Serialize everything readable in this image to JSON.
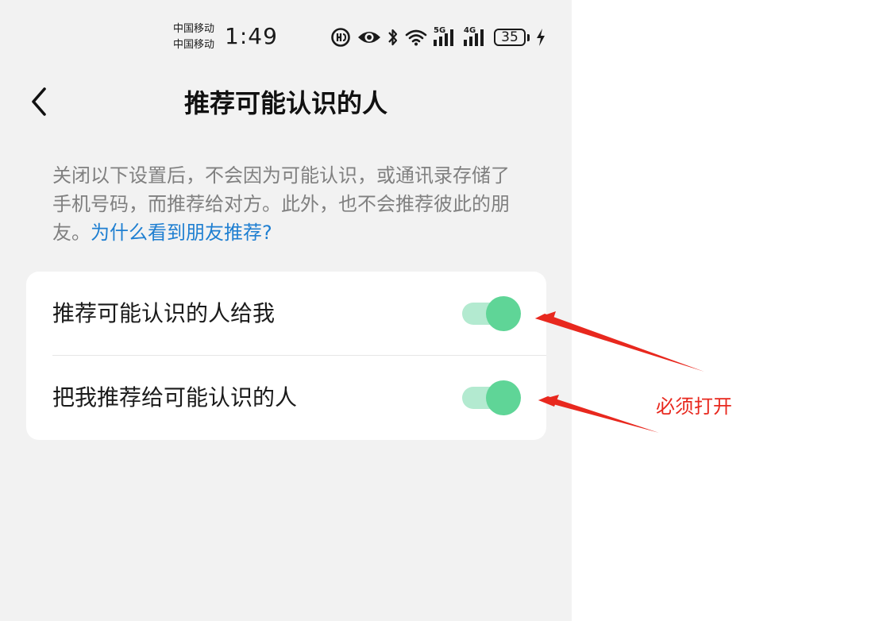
{
  "status_bar": {
    "carrier_1": "中国移动",
    "carrier_2": "中国移动",
    "time": "1:49",
    "network_1": "5G",
    "network_2": "4G",
    "battery": "35",
    "icons": [
      "hd-call-icon",
      "eye-icon",
      "bluetooth-icon",
      "wifi-icon",
      "signal-5g-icon",
      "signal-4g-icon",
      "battery-icon",
      "charging-icon"
    ]
  },
  "header": {
    "back_icon": "chevron-left-icon",
    "title": "推荐可能认识的人"
  },
  "description": {
    "text": "关闭以下设置后，不会因为可能认识，或通讯录存储了手机号码，而推荐给对方。此外，也不会推荐彼此的朋友。",
    "link": "为什么看到朋友推荐?"
  },
  "settings": [
    {
      "label": "推荐可能认识的人给我",
      "enabled": true
    },
    {
      "label": "把我推荐给可能认识的人",
      "enabled": true
    }
  ],
  "colors": {
    "page_background": "#f2f2f2",
    "card_background": "#ffffff",
    "toggle_track_on": "#b3ead0",
    "toggle_knob_on": "#5fd597",
    "link": "#1f7fd1",
    "annotation": "#e8281e"
  },
  "annotation": {
    "text": "必须打开"
  }
}
